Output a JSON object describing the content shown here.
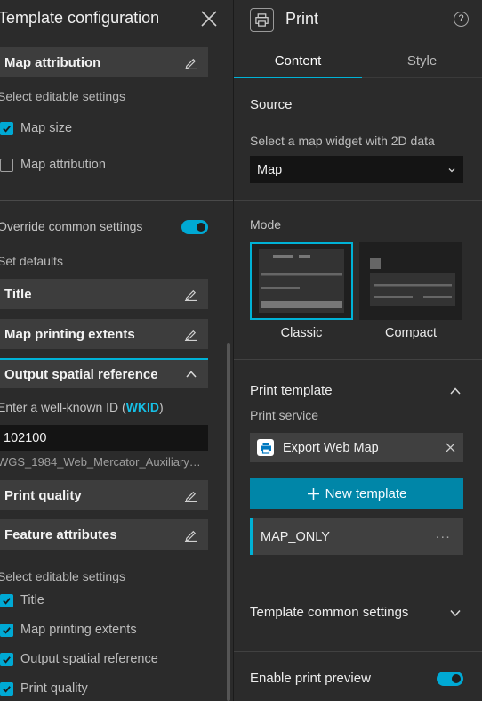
{
  "left": {
    "title": "Template configuration",
    "map_attribution_bar": "Map attribution",
    "select_editable_1": "Select editable settings",
    "checks_top": [
      {
        "label": "Map size",
        "checked": true
      },
      {
        "label": "Map attribution",
        "checked": false
      }
    ],
    "override_label": "Override common settings",
    "set_defaults": "Set defaults",
    "bars": {
      "title": "Title",
      "extents": "Map printing extents",
      "spatial_ref": "Output spatial reference",
      "quality": "Print quality",
      "feature_attr": "Feature attributes"
    },
    "wkid_prompt_prefix": "Enter a well-known ID (",
    "wkid_link": "WKID",
    "wkid_prompt_suffix": ")",
    "wkid_value": "102100",
    "wkid_name": "WGS_1984_Web_Mercator_Auxiliary…",
    "select_editable_2": "Select editable settings",
    "checks_bottom": [
      {
        "label": "Title",
        "checked": true
      },
      {
        "label": "Map printing extents",
        "checked": true
      },
      {
        "label": "Output spatial reference",
        "checked": true
      },
      {
        "label": "Print quality",
        "checked": true
      }
    ]
  },
  "right": {
    "title": "Print",
    "help": "?",
    "tabs": {
      "content": "Content",
      "style": "Style"
    },
    "source_title": "Source",
    "source_prompt": "Select a map widget with 2D data",
    "source_value": "Map",
    "mode_title": "Mode",
    "modes": {
      "classic": "Classic",
      "compact": "Compact"
    },
    "print_template_title": "Print template",
    "print_service_label": "Print service",
    "service_name": "Export Web Map",
    "new_template": "New template",
    "template_item": "MAP_ONLY",
    "template_more": "···",
    "common_settings": "Template common settings",
    "enable_preview": "Enable print preview"
  },
  "colors": {
    "accent": "#00b2d6",
    "button": "#0086a8",
    "panel": "#2b2b2b",
    "bar": "#3d3d3d"
  }
}
